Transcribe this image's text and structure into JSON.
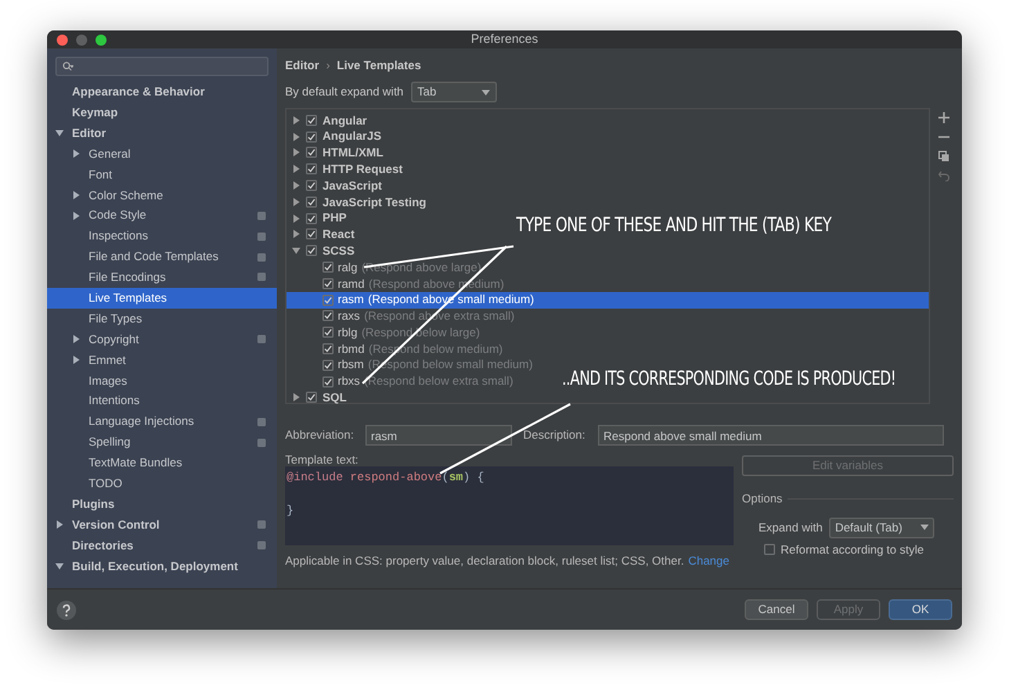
{
  "window": {
    "title": "Preferences"
  },
  "sidebar": {
    "items": [
      {
        "label": "Appearance & Behavior",
        "top": true,
        "expandable": false,
        "shared": false,
        "selected": false
      },
      {
        "label": "Keymap",
        "top": true,
        "expandable": false,
        "shared": false,
        "selected": false
      },
      {
        "label": "Editor",
        "top": true,
        "expandable": true,
        "expanded": true,
        "shared": false,
        "selected": false,
        "children": [
          {
            "label": "General",
            "expandable": true,
            "expanded": false,
            "shared": false,
            "selected": false
          },
          {
            "label": "Font",
            "expandable": false,
            "shared": false,
            "selected": false
          },
          {
            "label": "Color Scheme",
            "expandable": true,
            "expanded": false,
            "shared": false,
            "selected": false
          },
          {
            "label": "Code Style",
            "expandable": true,
            "expanded": false,
            "shared": true,
            "selected": false
          },
          {
            "label": "Inspections",
            "expandable": false,
            "shared": true,
            "selected": false
          },
          {
            "label": "File and Code Templates",
            "expandable": false,
            "shared": true,
            "selected": false
          },
          {
            "label": "File Encodings",
            "expandable": false,
            "shared": true,
            "selected": false
          },
          {
            "label": "Live Templates",
            "expandable": false,
            "shared": false,
            "selected": true
          },
          {
            "label": "File Types",
            "expandable": false,
            "shared": false,
            "selected": false
          },
          {
            "label": "Copyright",
            "expandable": true,
            "expanded": false,
            "shared": true,
            "selected": false
          },
          {
            "label": "Emmet",
            "expandable": true,
            "expanded": false,
            "shared": false,
            "selected": false
          },
          {
            "label": "Images",
            "expandable": false,
            "shared": false,
            "selected": false
          },
          {
            "label": "Intentions",
            "expandable": false,
            "shared": false,
            "selected": false
          },
          {
            "label": "Language Injections",
            "expandable": false,
            "shared": true,
            "selected": false
          },
          {
            "label": "Spelling",
            "expandable": false,
            "shared": true,
            "selected": false
          },
          {
            "label": "TextMate Bundles",
            "expandable": false,
            "shared": false,
            "selected": false
          },
          {
            "label": "TODO",
            "expandable": false,
            "shared": false,
            "selected": false
          }
        ]
      },
      {
        "label": "Plugins",
        "top": true,
        "expandable": false,
        "shared": false,
        "selected": false
      },
      {
        "label": "Version Control",
        "top": true,
        "expandable": true,
        "expanded": false,
        "shared": true,
        "selected": false
      },
      {
        "label": "Directories",
        "top": true,
        "expandable": false,
        "shared": true,
        "selected": false
      },
      {
        "label": "Build, Execution, Deployment",
        "top": true,
        "expandable": true,
        "expanded": true,
        "shared": false,
        "selected": false
      }
    ]
  },
  "breadcrumb": {
    "items": [
      "Editor",
      "Live Templates"
    ],
    "separator": "›"
  },
  "expand_default": {
    "label": "By default expand with",
    "value": "Tab"
  },
  "template_groups": [
    {
      "name": "Angular",
      "checked": true,
      "expanded": false
    },
    {
      "name": "AngularJS",
      "checked": true,
      "expanded": false
    },
    {
      "name": "HTML/XML",
      "checked": true,
      "expanded": false
    },
    {
      "name": "HTTP Request",
      "checked": true,
      "expanded": false
    },
    {
      "name": "JavaScript",
      "checked": true,
      "expanded": false
    },
    {
      "name": "JavaScript Testing",
      "checked": true,
      "expanded": false
    },
    {
      "name": "PHP",
      "checked": true,
      "expanded": false
    },
    {
      "name": "React",
      "checked": true,
      "expanded": false
    },
    {
      "name": "SCSS",
      "checked": true,
      "expanded": true,
      "children": [
        {
          "abbreviation": "ralg",
          "description": "(Respond above large)",
          "checked": true,
          "selected": false
        },
        {
          "abbreviation": "ramd",
          "description": "(Respond above medium)",
          "checked": true,
          "selected": false
        },
        {
          "abbreviation": "rasm",
          "description": "(Respond above small medium)",
          "checked": true,
          "selected": true
        },
        {
          "abbreviation": "raxs",
          "description": "(Respond above extra small)",
          "checked": true,
          "selected": false
        },
        {
          "abbreviation": "rblg",
          "description": "(Respond below large)",
          "checked": true,
          "selected": false
        },
        {
          "abbreviation": "rbmd",
          "description": "(Respond below medium)",
          "checked": true,
          "selected": false
        },
        {
          "abbreviation": "rbsm",
          "description": "(Respond below small medium)",
          "checked": true,
          "selected": false
        },
        {
          "abbreviation": "rbxs",
          "description": "(Respond below extra small)",
          "checked": true,
          "selected": false
        }
      ]
    },
    {
      "name": "SQL",
      "checked": true,
      "expanded": false
    }
  ],
  "abbreviation": {
    "label": "Abbreviation:",
    "value": "rasm"
  },
  "description": {
    "label": "Description:",
    "value": "Respond above small medium"
  },
  "template_text": {
    "label": "Template text:",
    "lines": [
      {
        "tokens": [
          {
            "kind": "keyword",
            "text": "@include"
          },
          {
            "kind": "function",
            "text": "respond-above",
            "space_before": true
          },
          {
            "kind": "plain",
            "text": "("
          },
          {
            "kind": "variable",
            "text": "sm"
          },
          {
            "kind": "plain",
            "text": ") {"
          }
        ]
      },
      {
        "gap_before": true,
        "tokens": [
          {
            "kind": "plain",
            "text": "}"
          }
        ]
      }
    ]
  },
  "edit_variables": {
    "label": "Edit variables",
    "disabled": true
  },
  "options": {
    "title": "Options",
    "expand_with": {
      "label": "Expand with",
      "value": "Default (Tab)"
    },
    "reformat": {
      "label": "Reformat according to style",
      "checked": false
    }
  },
  "applicable": {
    "text": "Applicable in CSS: property value, declaration block, ruleset list; CSS, Other.",
    "link": "Change"
  },
  "buttons": [
    {
      "label": "Cancel",
      "kind": "normal"
    },
    {
      "label": "Apply",
      "kind": "disabled"
    },
    {
      "label": "OK",
      "kind": "default"
    }
  ],
  "annotations": [
    "TYPE ONE OF THESE AND HIT THE (TAB) KEY",
    "..AND ITS CORRESPONDING CODE IS PRODUCED!"
  ]
}
